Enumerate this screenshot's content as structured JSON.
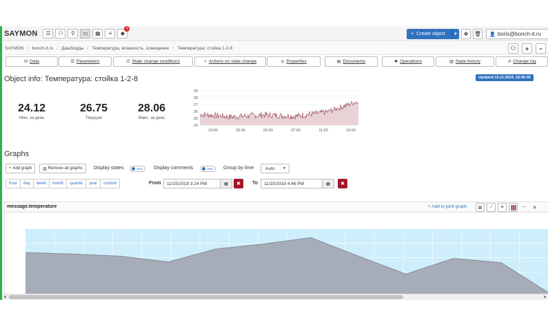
{
  "app": {
    "brand": "SAYMON"
  },
  "topnav": {
    "create_label": "Create object",
    "user_label": "boris@bonch-it.ru",
    "notifications_count": "9"
  },
  "breadcrumb": [
    "SAYMON",
    "bonch-it.ru",
    "Дашборды",
    "Температура, влажность, освещение",
    "Температура: стойка 1-2-8"
  ],
  "tabs": [
    "Data",
    "Parameters",
    "State change conditions",
    "Actions on state change",
    "Properties",
    "Documents",
    "Operations",
    "State history",
    "Change log"
  ],
  "object": {
    "title": "Object info: Температура: стойка 1-2-8",
    "updated": "Updated 15.11.2019, 16:45:35"
  },
  "metrics": [
    {
      "value": "24.12",
      "label": "Мин. за день"
    },
    {
      "value": "26.75",
      "label": "Текущая"
    },
    {
      "value": "28.06",
      "label": "Макс. за день"
    }
  ],
  "sparkline": {
    "y_ticks": [
      "29",
      "28",
      "27",
      "26",
      "25",
      "24"
    ],
    "x_ticks": [
      "19:00",
      "23:00",
      "03:00",
      "07:00",
      "11:00",
      "15:00"
    ],
    "ylim": [
      24,
      29
    ],
    "line_color": "#8b3a4a",
    "fill_color": "#e8d2d6"
  },
  "graphs": {
    "title": "Graphs",
    "add_graph": "Add graph",
    "remove_all": "Remove all graphs",
    "display_states": "Display states",
    "display_comments": "Display comments",
    "toggle_yes": "YES",
    "group_by_time": "Group by time",
    "group_value": "Auto",
    "periods": [
      "hour",
      "day",
      "week",
      "month",
      "quarter",
      "year",
      "custom"
    ],
    "from_label": "From",
    "from_value": "11/15/2019 3:24 PM",
    "to_label": "To",
    "to_value": "11/15/2019 4:46 PM"
  },
  "panel": {
    "title": "message.temperature",
    "add_joint": "Add to joint graph"
  },
  "chart_data": [
    {
      "type": "line",
      "x": [
        "19:00",
        "23:00",
        "03:00",
        "07:00",
        "11:00",
        "15:00"
      ],
      "values": [
        25.6,
        25.2,
        25.5,
        25.3,
        25.9,
        27.5
      ],
      "ylim": [
        24,
        29
      ],
      "grid": true
    },
    {
      "type": "area",
      "values": [
        0.67,
        0.65,
        0.62,
        0.54,
        0.72,
        0.79,
        0.88,
        0.62,
        0.37,
        0.59,
        0.53,
        0.11
      ],
      "ylim": [
        0,
        1
      ],
      "grid": true,
      "band_color": "#cdeefa",
      "area_color": "#a7adb8"
    }
  ]
}
